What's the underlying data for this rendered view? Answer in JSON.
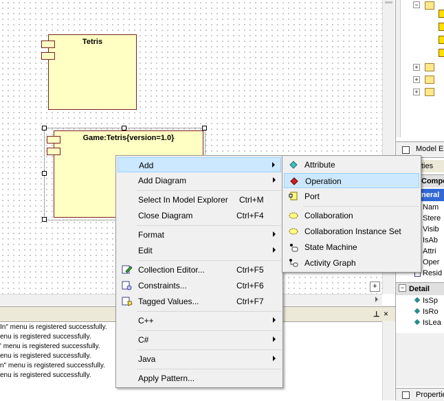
{
  "diagram": {
    "components": [
      {
        "name": "Tetris"
      },
      {
        "name": "Game:Tetris{version=1.0}"
      }
    ]
  },
  "right_panel": {
    "model_explorer_tab": "Model Ex",
    "properties_header": "ties",
    "compo_header": "Compo",
    "general_header": "neral",
    "properties": [
      "Nam",
      "Stere",
      "Visib",
      "IsAb",
      "Attri",
      "Oper",
      "Resid"
    ],
    "detail_header": "Detail",
    "detail_properties": [
      "IsSp",
      "IsRo",
      "IsLea"
    ],
    "bottom_tab": "Propertie"
  },
  "output": {
    "lines": [
      "In\" menu is registered successfully.",
      "enu is registered successfully.",
      "' menu is registered successfully.",
      "enu is registered successfully.",
      "n\" menu is registered successfully.",
      "enu is registered successfully."
    ],
    "pin_icon": "pin-icon",
    "close_icon": "close-icon"
  },
  "context_menu": {
    "items": [
      {
        "label": "Add",
        "shortcut": "",
        "submenu": true,
        "highlighted": true
      },
      {
        "label": "Add Diagram",
        "shortcut": "",
        "submenu": true
      },
      {
        "label": "Select In Model Explorer",
        "shortcut": "Ctrl+M"
      },
      {
        "label": "Close Diagram",
        "shortcut": "Ctrl+F4"
      },
      {
        "label": "Format",
        "shortcut": "",
        "submenu": true
      },
      {
        "label": "Edit",
        "shortcut": "",
        "submenu": true
      },
      {
        "label": "Collection Editor...",
        "shortcut": "Ctrl+F5",
        "icon": "collection-editor-icon"
      },
      {
        "label": "Constraints...",
        "shortcut": "Ctrl+F6",
        "icon": "constraints-icon"
      },
      {
        "label": "Tagged Values...",
        "shortcut": "Ctrl+F7",
        "icon": "tagged-values-icon"
      },
      {
        "label": "C++",
        "shortcut": "",
        "submenu": true
      },
      {
        "label": "C#",
        "shortcut": "",
        "submenu": true
      },
      {
        "label": "Java",
        "shortcut": "",
        "submenu": true
      },
      {
        "label": "Apply Pattern...",
        "shortcut": ""
      }
    ]
  },
  "add_submenu": {
    "items": [
      {
        "label": "Attribute",
        "icon": "attribute-icon"
      },
      {
        "label": "Operation",
        "icon": "operation-icon",
        "highlighted": true
      },
      {
        "label": "Port",
        "icon": "port-icon"
      },
      {
        "label": "Collaboration",
        "icon": "collaboration-icon"
      },
      {
        "label": "Collaboration Instance Set",
        "icon": "collaboration-instance-set-icon"
      },
      {
        "label": "State Machine",
        "icon": "state-machine-icon"
      },
      {
        "label": "Activity Graph",
        "icon": "activity-graph-icon"
      }
    ]
  },
  "colors": {
    "component_fill": "#ffffc4",
    "component_border": "#7a1f1f",
    "menu_bg": "#f0f0f0",
    "highlight": "#cce8ff"
  }
}
